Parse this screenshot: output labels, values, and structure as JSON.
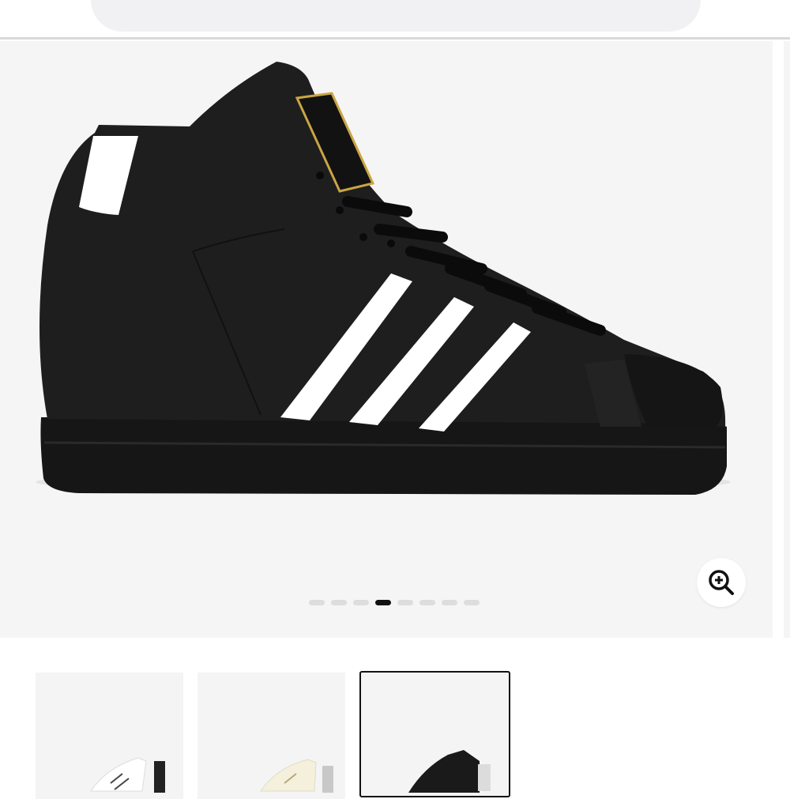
{
  "header": {
    "search_icon": "search-icon",
    "bookmark_icon": "bookmark-icon",
    "bag_icon": "shopping-bag-icon"
  },
  "gallery": {
    "image_alt_icon": "product-image",
    "zoom_icon": "zoom-in-icon",
    "slide_count": 8,
    "active_slide": 4
  },
  "thumbnails": [
    {
      "variant": "white",
      "selected": false
    },
    {
      "variant": "cream",
      "selected": false
    },
    {
      "variant": "black",
      "selected": true
    }
  ],
  "colors": {
    "background": "#ffffff",
    "gallery_bg": "#f5f5f5",
    "shoe": "#1c1c1c",
    "stripes": "#ffffff",
    "gold": "#c9a544",
    "active_dot": "#111111",
    "inactive_dot": "#dddddd"
  }
}
